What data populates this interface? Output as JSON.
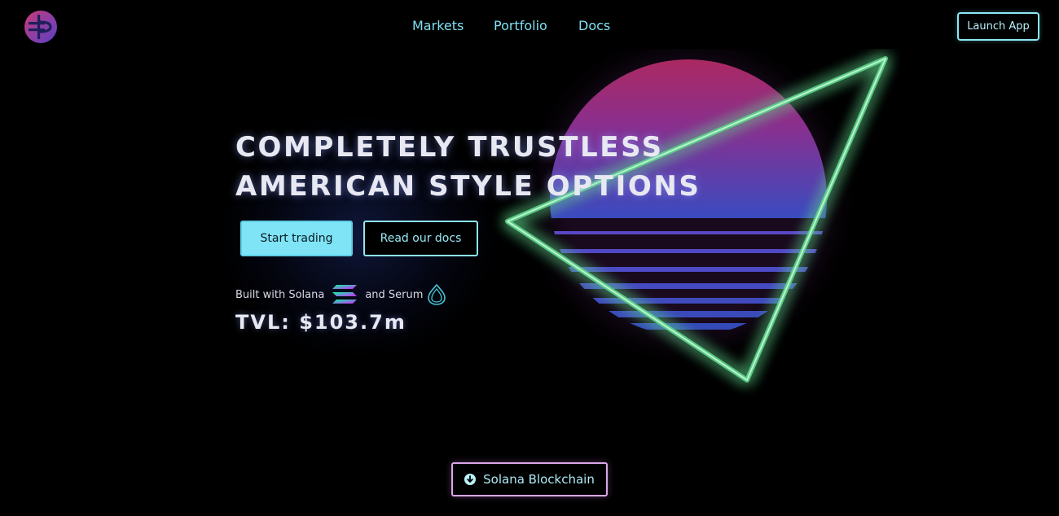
{
  "header": {
    "logo_icon": "opium-logo-icon",
    "nav": [
      {
        "label": "Markets"
      },
      {
        "label": "Portfolio"
      },
      {
        "label": "Docs"
      }
    ],
    "launch_label": "Launch App"
  },
  "hero": {
    "title_line1": "COMPLETELY TRUSTLESS",
    "title_line2": "AMERICAN STYLE OPTIONS",
    "start_label": "Start trading",
    "docs_label": "Read our docs",
    "built_with": "Built with Solana",
    "and_serum": "and Serum",
    "tvl_label": "TVL:",
    "tvl_value": "$103.7m"
  },
  "footer": {
    "chain_label": "Solana Blockchain",
    "chain_icon": "arrow-down-circle-icon"
  },
  "colors": {
    "background": "#000000",
    "accent_cyan": "#7fe4f6",
    "neon_green": "#5fd38a",
    "sun_top": "#b0285a",
    "sun_bottom": "#4a3fb0",
    "chain_border": "#d9a7e6"
  }
}
